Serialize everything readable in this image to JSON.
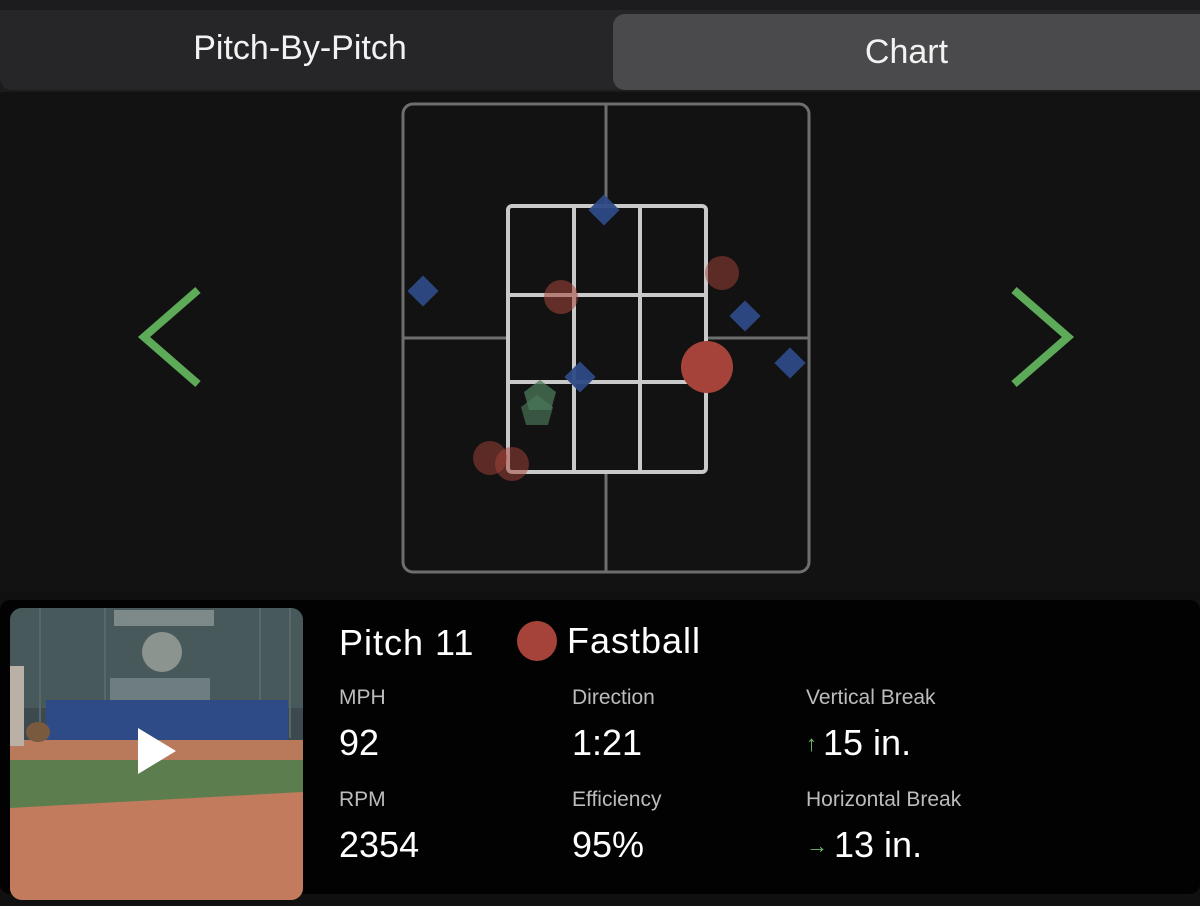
{
  "tabs": [
    {
      "label": "Pitch-By-Pitch",
      "selected": false
    },
    {
      "label": "Chart",
      "selected": true
    }
  ],
  "navigation": {
    "prev_icon": "chevron-left-icon",
    "next_icon": "chevron-right-icon",
    "arrow_color": "#5daa58"
  },
  "colors": {
    "fastball": "#a5433a",
    "blue_pitch": "#2e4b86",
    "green_pitch": "#4c7a5a",
    "grid": "#c9c9c9",
    "outer_grid": "#6e6e6e"
  },
  "pitch_markers": [
    {
      "shape": "diamond",
      "color": "blue"
    },
    {
      "shape": "diamond",
      "color": "blue"
    },
    {
      "shape": "diamond",
      "color": "blue"
    },
    {
      "shape": "diamond",
      "color": "blue"
    },
    {
      "shape": "diamond",
      "color": "blue"
    },
    {
      "shape": "circle",
      "color": "red"
    },
    {
      "shape": "circle",
      "color": "red"
    },
    {
      "shape": "circle",
      "color": "red"
    },
    {
      "shape": "circle",
      "color": "red"
    },
    {
      "shape": "pentagon",
      "color": "green"
    },
    {
      "shape": "pentagon",
      "color": "green"
    },
    {
      "shape": "circle",
      "color": "red",
      "highlighted": true
    }
  ],
  "pitch": {
    "title": "Pitch 11",
    "type": "Fastball",
    "play_icon": "play-icon"
  },
  "stats": {
    "mph_label": "MPH",
    "mph": "92",
    "direction_label": "Direction",
    "direction": "1:21",
    "vertical_break_label": "Vertical Break",
    "vertical_break": "15 in.",
    "vertical_break_icon": "arrow-up-icon",
    "rpm_label": "RPM",
    "rpm": "2354",
    "efficiency_label": "Efficiency",
    "efficiency": "95%",
    "horizontal_break_label": "Horizontal Break",
    "horizontal_break": "13 in.",
    "horizontal_break_icon": "arrow-right-icon"
  }
}
